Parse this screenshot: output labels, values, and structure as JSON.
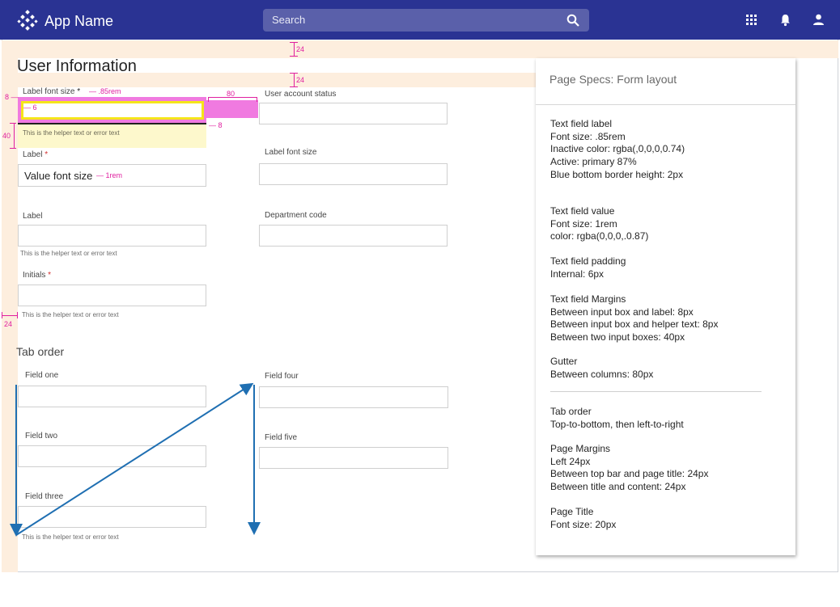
{
  "app_bar": {
    "app_name": "App Name",
    "search_placeholder": "Search",
    "icons": [
      "apps-grid-icon",
      "bell-icon",
      "user-icon"
    ],
    "color": "#2a3393"
  },
  "page": {
    "title": "User Information",
    "tab_order_title": "Tab order"
  },
  "form": {
    "label_font_size": "Label font size",
    "required_star": "*",
    "user_account_status": "User account status",
    "label": "Label",
    "label_font_size_2": "Label font size",
    "value_font_size": "Value font size",
    "label_3": "Label",
    "department_code": "Department code",
    "initials": "Initials",
    "helper_text": "This is the helper text or error text"
  },
  "annotations": {
    "label_rem": ".85rem",
    "value_rem": "1rem",
    "padding_6": "6",
    "gutter_80": "80",
    "left_8": "8",
    "below_8": "8",
    "gap_40": "40",
    "top_24": "24",
    "title_24": "24",
    "margin_24": "24",
    "color": "#e020a0"
  },
  "tab_order": {
    "field_one": "Field one",
    "field_two": "Field two",
    "field_three": "Field three",
    "field_four": "Field four",
    "field_five": "Field five",
    "helper_text": "This is the helper text or error text",
    "arrow_color": "#1f6fb2"
  },
  "specs": {
    "title": "Page Specs:  Form layout",
    "groups": [
      [
        "Text field  label",
        "Font size: .85rem",
        "Inactive color:  rgba(,0,0,0,0.74)",
        "Active: primary  87%",
        "Blue bottom border height:  2px"
      ],
      [
        "Text field value",
        "Font size:  1rem",
        "color:  rgba(0,0,0,.0.87)"
      ],
      [
        "Text field padding",
        "Internal: 6px"
      ],
      [
        "Text field Margins",
        "Between input box and label:  8px",
        "Between input box and helper text:  8px",
        "Between two input boxes:  40px"
      ],
      [
        "Gutter",
        "Between columns:  80px"
      ],
      [
        "Tab order",
        "Top-to-bottom, then left-to-right"
      ],
      [
        "Page Margins",
        "Left 24px",
        "Between top bar and page title:  24px",
        "Between title and content:  24px"
      ],
      [
        "Page Title",
        "Font size:  20px"
      ]
    ]
  }
}
